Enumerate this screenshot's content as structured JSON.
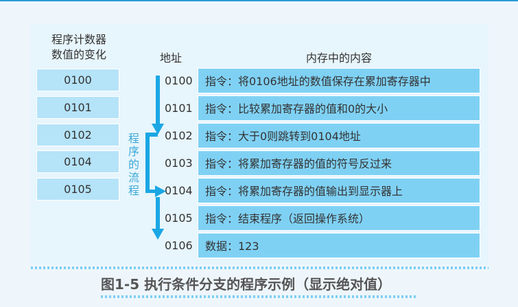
{
  "headers": {
    "pc": [
      "程序计数器",
      "数值的变化"
    ],
    "address": "地址",
    "memory": "内存中的内容"
  },
  "pc_values": [
    "0100",
    "0101",
    "0102",
    "0104",
    "0105"
  ],
  "flow_label": [
    "程",
    "序",
    "的",
    "流",
    "程"
  ],
  "memory": [
    {
      "address": "0100",
      "content": "指令：将0106地址的数值保存在累加寄存器中"
    },
    {
      "address": "0101",
      "content": "指令：比较累加寄存器的值和0的大小"
    },
    {
      "address": "0102",
      "content": "指令：大于0则跳转到0104地址"
    },
    {
      "address": "0103",
      "content": "指令：将累加寄存器的值的符号反过来"
    },
    {
      "address": "0104",
      "content": "指令：将累加寄存器的值输出到显示器上"
    },
    {
      "address": "0105",
      "content": "指令：结束程序（返回操作系统）"
    },
    {
      "address": "0106",
      "content": "数据：123"
    }
  ],
  "caption": "图1-5 执行条件分支的程序示例（显示绝对值）",
  "colors": {
    "arrow": "#1aa7e4",
    "row": "#7fd1f4",
    "pc": "#b5e3f8"
  }
}
